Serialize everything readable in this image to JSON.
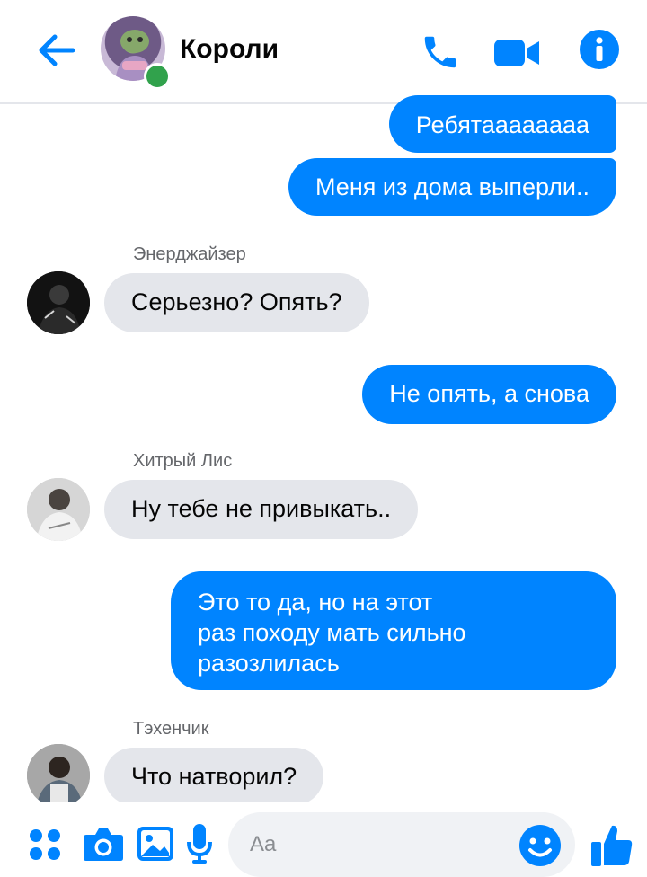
{
  "header": {
    "title": "Короли",
    "back_icon": "arrow-left-icon",
    "actions": [
      "phone-icon",
      "video-camera-icon",
      "info-icon"
    ]
  },
  "colors": {
    "accent": "#0084ff",
    "incoming_bubble": "#e4e6eb",
    "online": "#31a24c",
    "sender_text": "#65676b"
  },
  "messages": [
    {
      "direction": "outgoing",
      "text": "Ребятаааааааа"
    },
    {
      "direction": "outgoing",
      "text": "Меня из дома выперли.."
    },
    {
      "direction": "incoming",
      "sender": "Энерджайзер",
      "text": "Серьезно? Опять?"
    },
    {
      "direction": "outgoing",
      "text": "Не опять, а снова"
    },
    {
      "direction": "incoming",
      "sender": "Хитрый Лис",
      "text": "Ну тебе не привыкать.."
    },
    {
      "direction": "outgoing",
      "lines": [
        "Это то да, но на этот",
        "раз походу мать сильно",
        "разозлилась"
      ]
    },
    {
      "direction": "incoming",
      "sender": "Тэхенчик",
      "text": "Что натворил?"
    }
  ],
  "composer": {
    "placeholder": "Aa",
    "icons": [
      "apps-icon",
      "camera-icon",
      "gallery-icon",
      "microphone-icon",
      "emoji-icon",
      "thumbs-up-icon"
    ]
  }
}
